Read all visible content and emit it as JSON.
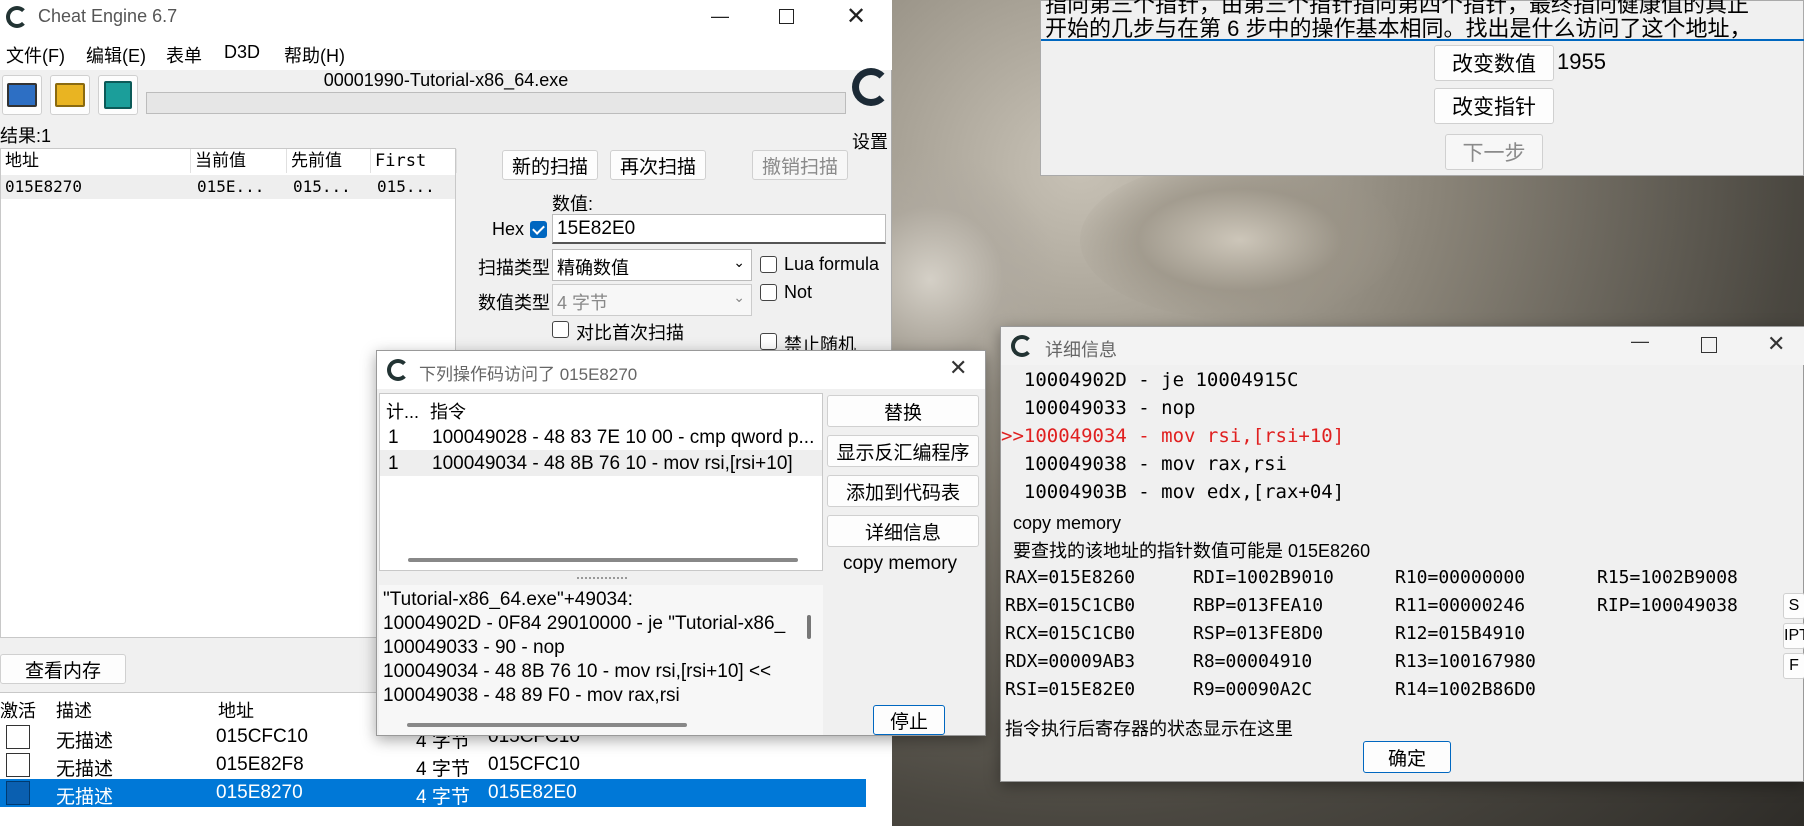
{
  "ce": {
    "title": "Cheat Engine 6.7",
    "menu": [
      "文件(F)",
      "编辑(E)",
      "表单",
      "D3D",
      "帮助(H)"
    ],
    "process": "00001990-Tutorial-x86_64.exe",
    "settings": "设置",
    "results": "结果:1",
    "columns": [
      "地址",
      "当前值",
      "先前值",
      "First"
    ],
    "result_row": [
      "015E8270",
      "015E...",
      "015...",
      "015..."
    ],
    "new_scan": "新的扫描",
    "next_scan": "再次扫描",
    "undo_scan": "撤销扫描",
    "value_label": "数值:",
    "hex_label": "Hex",
    "value": "15E82E0",
    "scan_type_label": "扫描类型",
    "scan_type": "精确数值",
    "value_type_label": "数值类型",
    "value_type": "4 字节",
    "lua_formula": "Lua formula",
    "not_label": "Not",
    "compare_first": "对比首次扫描",
    "disable_random": "禁止随机",
    "view_memory": "查看内存",
    "table_headers": [
      "激活",
      "描述",
      "地址"
    ],
    "table_rows": [
      {
        "desc": "无描述",
        "addr": "015CFC10",
        "type": "4 字节",
        "value": "015CFC10"
      },
      {
        "desc": "无描述",
        "addr": "015E82F8",
        "type": "4 字节",
        "value": "015CFC10"
      },
      {
        "desc": "无描述",
        "addr": "015E8270",
        "type": "4 字节",
        "value": "015E82E0"
      }
    ]
  },
  "tutorial": {
    "line1": "指向第三个指针，由第三个指针指向第四个指针，最终指向健康值的真正",
    "line2": "开始的几步与在第 6 步中的操作基本相同。找出是什么访问了这个地址，",
    "change_value": "改变数值",
    "value": "1955",
    "change_pointer": "改变指针",
    "next": "下一步"
  },
  "access": {
    "title": "下列操作码访问了 015E8270",
    "col_count": "计...",
    "col_instr": "指令",
    "rows": [
      {
        "count": "1",
        "instr": "100049028 - 48 83 7E 10 00 - cmp qword p..."
      },
      {
        "count": "1",
        "instr": "100049034 - 48 8B 76 10  - mov rsi,[rsi+10]"
      }
    ],
    "replace": "替换",
    "show_disasm": "显示反汇编程序",
    "add_to_codelist": "添加到代码表",
    "details": "详细信息",
    "copy_memory": "copy memory",
    "disasm": [
      "\"Tutorial-x86_64.exe\"+49034:",
      "10004902D - 0F84 29010000 - je \"Tutorial-x86_",
      "100049033 - 90 - nop",
      "100049034 - 48 8B 76 10  - mov rsi,[rsi+10] <<",
      "100049038 - 48 89 F0  - mov rax,rsi"
    ],
    "stop": "停止"
  },
  "details": {
    "title": "详细信息",
    "code": [
      {
        "text": "  10004902D - je 10004915C",
        "hl": false
      },
      {
        "text": "  100049033 - nop",
        "hl": false
      },
      {
        "text": ">>100049034 - mov rsi,[rsi+10]",
        "hl": true
      },
      {
        "text": "  100049038 - mov rax,rsi",
        "hl": false
      },
      {
        "text": "  10004903B - mov edx,[rax+04]",
        "hl": false
      }
    ],
    "copy_memory": "copy memory",
    "pointer_hint": "要查找的该地址的指针数值可能是 015E8260",
    "registers": [
      [
        "RAX=015E8260",
        "RDI=1002B9010",
        "R10=00000000",
        "R15=1002B9008"
      ],
      [
        "RBX=015C1CB0",
        "RBP=013FEA10",
        "R11=00000246",
        "RIP=100049038"
      ],
      [
        "RCX=015C1CB0",
        "RSP=013FE8D0",
        "R12=015B4910",
        ""
      ],
      [
        "RDX=00009AB3",
        "R8=00004910",
        "R13=100167980",
        ""
      ],
      [
        "RSI=015E82E0",
        "R9=00090A2C",
        "R14=1002B86D0",
        ""
      ]
    ],
    "side_buttons": [
      "S",
      "IPT",
      "F"
    ],
    "status_hint": "指令执行后寄存器的状态显示在这里",
    "ok": "确定"
  },
  "colors": {
    "accent": "#0067c0",
    "highlight": "#e02020",
    "selected_row": "#0078d7"
  }
}
